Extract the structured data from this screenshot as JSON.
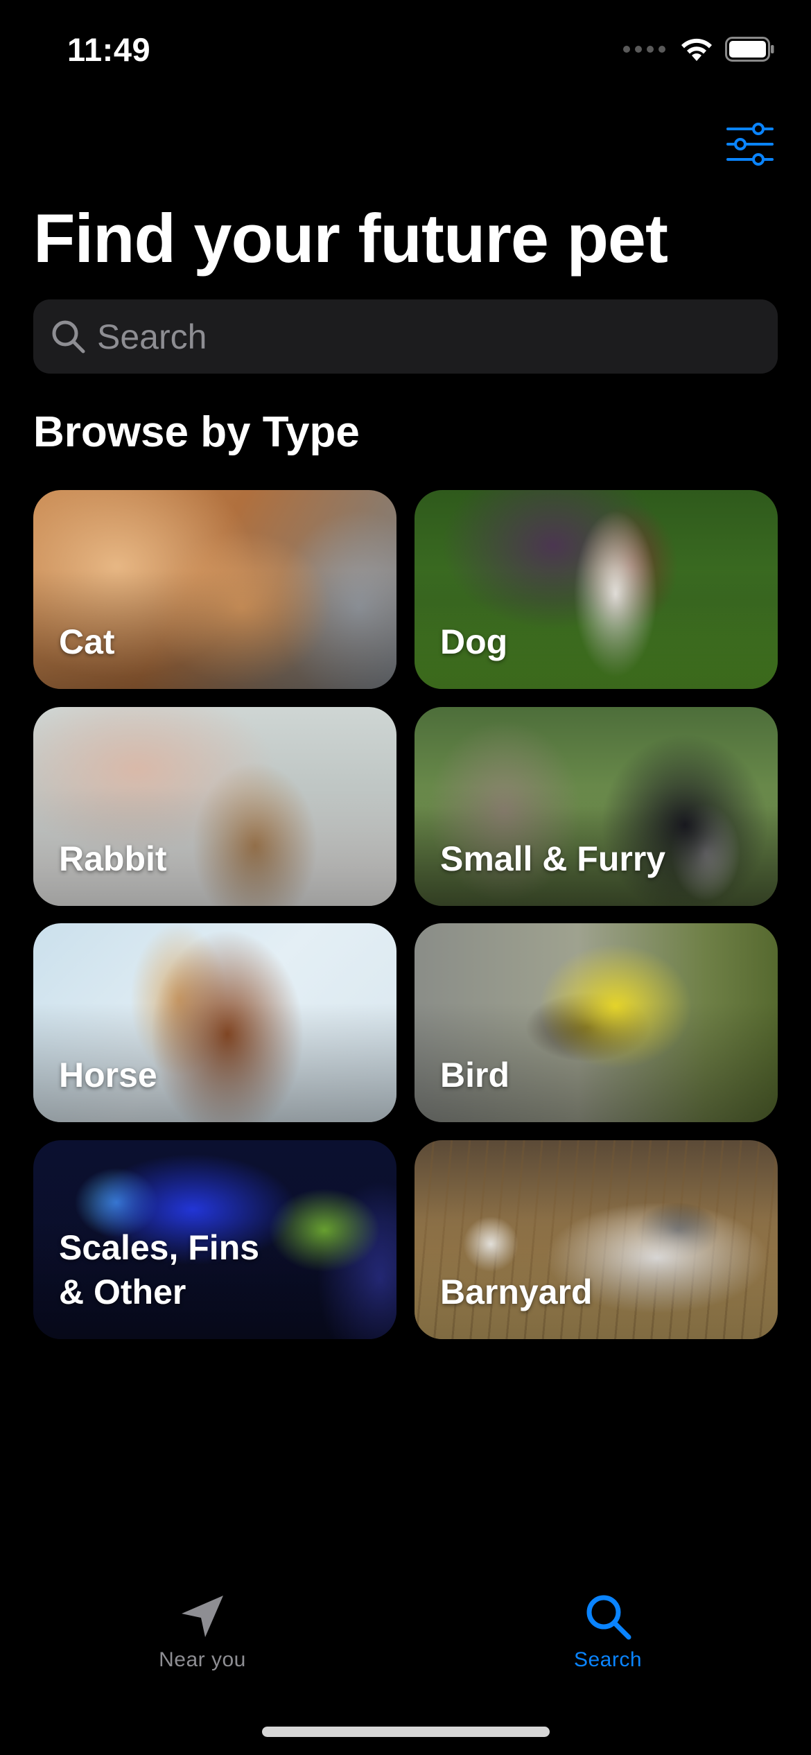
{
  "status_bar": {
    "time": "11:49"
  },
  "header": {
    "title": "Find your future pet",
    "filter_icon": "sliders-icon"
  },
  "search": {
    "placeholder": "Search",
    "value": ""
  },
  "browse": {
    "section_title": "Browse by Type",
    "types": [
      {
        "label": "Cat",
        "image": "cat-photo"
      },
      {
        "label": "Dog",
        "image": "dog-photo"
      },
      {
        "label": "Rabbit",
        "image": "rabbit-photo"
      },
      {
        "label": "Small & Furry",
        "image": "small-furry-photo"
      },
      {
        "label": "Horse",
        "image": "horse-photo"
      },
      {
        "label": "Bird",
        "image": "bird-photo"
      },
      {
        "label": "Scales, Fins\n& Other",
        "image": "fish-photo"
      },
      {
        "label": "Barnyard",
        "image": "calf-photo"
      }
    ]
  },
  "tab_bar": {
    "items": [
      {
        "label": "Near you",
        "icon": "location-arrow-icon",
        "selected": false
      },
      {
        "label": "Search",
        "icon": "magnifier-icon",
        "selected": true
      }
    ]
  },
  "colors": {
    "accent": "#0a84ff",
    "background": "#000000",
    "search_field": "#1c1c1e",
    "inactive_tab": "#8e8e93"
  }
}
